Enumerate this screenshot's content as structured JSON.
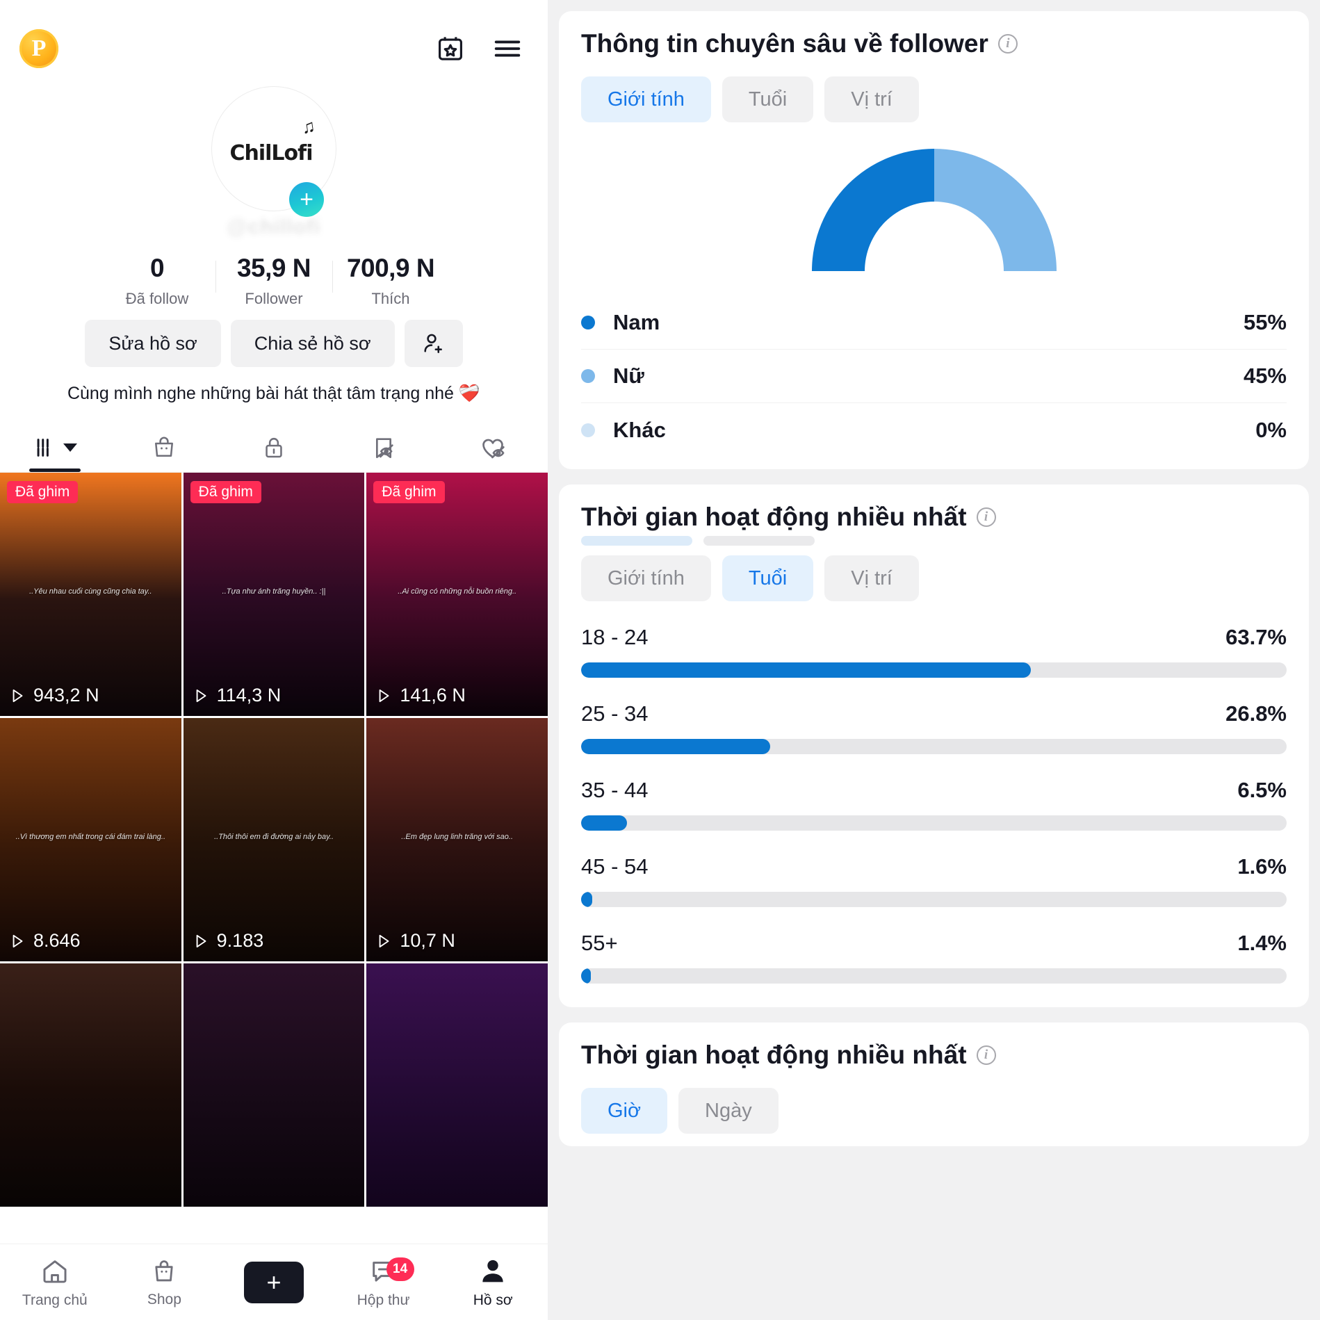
{
  "left": {
    "topbar": {
      "coin_label": "P",
      "calendar_icon": "calendar-star-icon",
      "menu_icon": "hamburger-menu-icon"
    },
    "profile": {
      "avatar_logo": "ChilLofi",
      "avatar_notes": "♫",
      "add_badge": "+",
      "username": "@chillofi",
      "bio": "Cùng mình nghe những bài hát thật tâm trạng nhé ❤️‍🩹"
    },
    "stats": [
      {
        "num": "0",
        "lbl": "Đã follow"
      },
      {
        "num": "35,9 N",
        "lbl": "Follower"
      },
      {
        "num": "700,9 N",
        "lbl": "Thích"
      }
    ],
    "actions": {
      "edit_label": "Sửa hồ sơ",
      "share_label": "Chia sẻ hồ sơ",
      "add_friend_icon": "add-person-icon"
    },
    "tabs": [
      {
        "icon": "grid-videos-icon",
        "active": true
      },
      {
        "icon": "shopping-bag-icon",
        "active": false
      },
      {
        "icon": "lock-private-icon",
        "active": false
      },
      {
        "icon": "bookmark-hidden-icon",
        "active": false
      },
      {
        "icon": "heart-hidden-icon",
        "active": false
      }
    ],
    "grid": [
      {
        "pin": "Đã ghim",
        "views": "943,2 N",
        "caption": "..Yêu nhau cuối cùng cũng chia tay..",
        "g1": "#f0761f",
        "g2": "#2a1410",
        "g3": "#0b0507"
      },
      {
        "pin": "Đã ghim",
        "views": "114,3 N",
        "caption": "..Tựa như ánh trăng huyền.. :||",
        "g1": "#6a1038",
        "g2": "#2b0a22",
        "g3": "#090309"
      },
      {
        "pin": "Đã ghim",
        "views": "141,6 N",
        "caption": "..Ai cũng có những nỗi buồn riêng..",
        "g1": "#b01048",
        "g2": "#4a0a2a",
        "g3": "#0a0208"
      },
      {
        "pin": "",
        "views": "8.646",
        "caption": "..Vì thương em nhất trong cái đám trai làng..",
        "g1": "#7a3a10",
        "g2": "#3a1a08",
        "g3": "#100604"
      },
      {
        "pin": "",
        "views": "9.183",
        "caption": "..Thôi thôi em đi đường ai nảy bay..",
        "g1": "#4a2a14",
        "g2": "#221208",
        "g3": "#0c0604"
      },
      {
        "pin": "",
        "views": "10,7 N",
        "caption": "..Em đẹp lung linh trăng với sao..",
        "g1": "#6a2a20",
        "g2": "#2e1210",
        "g3": "#0a0405"
      },
      {
        "pin": "",
        "views": "",
        "caption": "",
        "g1": "#3a2018",
        "g2": "#1a0c08",
        "g3": "#080404"
      },
      {
        "pin": "",
        "views": "",
        "caption": "",
        "g1": "#2a1028",
        "g2": "#180a18",
        "g3": "#0a040a"
      },
      {
        "pin": "",
        "views": "",
        "caption": "",
        "g1": "#3a1050",
        "g2": "#240a34",
        "g3": "#12041c"
      }
    ],
    "bottomnav": [
      {
        "label": "Trang chủ",
        "icon": "home-icon",
        "badge": "",
        "active": false
      },
      {
        "label": "Shop",
        "icon": "shopping-bag-icon",
        "badge": "",
        "active": false
      },
      {
        "label": "",
        "icon": "create-plus-icon",
        "badge": "",
        "active": false
      },
      {
        "label": "Hộp thư",
        "icon": "inbox-message-icon",
        "badge": "14",
        "active": false
      },
      {
        "label": "Hồ sơ",
        "icon": "profile-person-icon",
        "badge": "",
        "active": true
      }
    ]
  },
  "right": {
    "follower_insights": {
      "title": "Thông tin chuyên sâu về follower",
      "info_icon": "info-circle-icon",
      "tabs": [
        {
          "label": "Giới tính",
          "active": true
        },
        {
          "label": "Tuổi",
          "active": false
        },
        {
          "label": "Vị trí",
          "active": false
        }
      ]
    },
    "activity_age": {
      "title": "Thời gian hoạt động nhiều nhất",
      "info_icon": "info-circle-icon",
      "tabs": [
        {
          "label": "Giới tính",
          "active": false
        },
        {
          "label": "Tuổi",
          "active": true
        },
        {
          "label": "Vị trí",
          "active": false
        }
      ]
    },
    "activity_time": {
      "title": "Thời gian hoạt động nhiều nhất",
      "info_icon": "info-circle-icon",
      "tabs": [
        {
          "label": "Giờ",
          "active": true
        },
        {
          "label": "Ngày",
          "active": false
        }
      ]
    }
  },
  "colors": {
    "primary_blue": "#0b78d0",
    "light_blue": "#7db8ea",
    "pale_blue": "#cfe3f5",
    "accent_pink": "#fe2c55",
    "accent_cyan": "#25f4ee",
    "track_grey": "#e6e6e8",
    "pill_bg": "#f1f1f2",
    "pill_active_bg": "#e4f1fd",
    "pill_active_text": "#1677e8"
  },
  "chart_data": [
    {
      "type": "pie",
      "title": "Thông tin chuyên sâu về follower",
      "subtype": "semi-donut-gauge",
      "categories": [
        "Nam",
        "Nữ",
        "Khác"
      ],
      "values": [
        55,
        45,
        0
      ],
      "labels": [
        "55%",
        "45%",
        "0%"
      ],
      "colors": [
        "#0b78d0",
        "#7db8ea",
        "#cfe3f5"
      ],
      "legend": "bottom",
      "unit": "%"
    },
    {
      "type": "bar",
      "orientation": "horizontal",
      "title": "Thời gian hoạt động nhiều nhất",
      "categories": [
        "18 - 24",
        "25 - 34",
        "35 - 44",
        "45 - 54",
        "55+"
      ],
      "values": [
        63.7,
        26.8,
        6.5,
        1.6,
        1.4
      ],
      "labels": [
        "63.7%",
        "26.8%",
        "6.5%",
        "1.6%",
        "1.4%"
      ],
      "xlabel": "",
      "ylabel": "",
      "xlim": [
        0,
        100
      ],
      "grid": false,
      "bar_color": "#0b78d0",
      "track_color": "#e6e6e8",
      "unit": "%"
    }
  ]
}
